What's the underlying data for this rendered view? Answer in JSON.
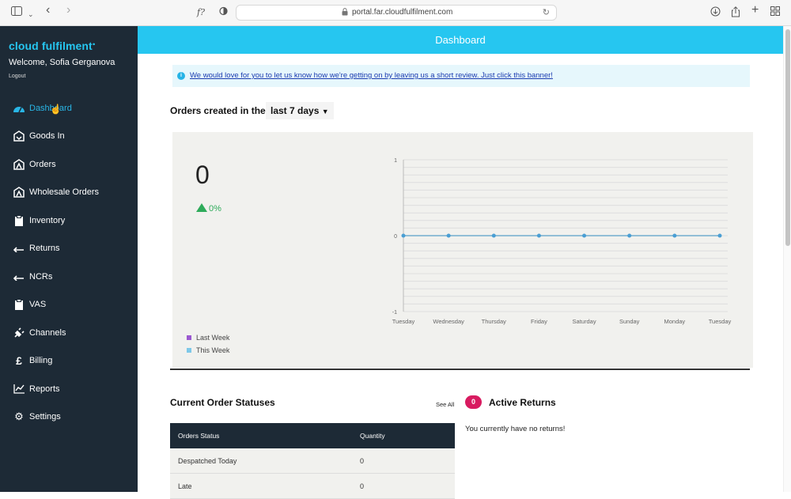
{
  "browser": {
    "url": "portal.far.cloudfulfilment.com",
    "icons": [
      "sidebar-toggle-icon",
      "chevron-down-icon",
      "back-icon",
      "forward-icon",
      "script-icon",
      "shield-icon",
      "lock-icon",
      "reload-icon",
      "download-icon",
      "share-icon",
      "new-tab-icon",
      "tab-overview-icon"
    ]
  },
  "sidebar": {
    "brand": "cloud fulfilment",
    "welcome": "Welcome, Sofia Gerganova",
    "logout": "Logout",
    "items": [
      {
        "label": "Dashboard",
        "icon": "dashboard-icon",
        "active": true
      },
      {
        "label": "Goods In",
        "icon": "box-in-icon"
      },
      {
        "label": "Orders",
        "icon": "order-box-icon"
      },
      {
        "label": "Wholesale Orders",
        "icon": "wholesale-box-icon"
      },
      {
        "label": "Inventory",
        "icon": "clipboard-icon"
      },
      {
        "label": "Returns",
        "icon": "return-arrow-icon"
      },
      {
        "label": "NCRs",
        "icon": "return-arrow-icon"
      },
      {
        "label": "VAS",
        "icon": "clipboard-icon"
      },
      {
        "label": "Channels",
        "icon": "plug-icon"
      },
      {
        "label": "Billing",
        "icon": "pound-icon"
      },
      {
        "label": "Reports",
        "icon": "line-chart-icon"
      },
      {
        "label": "Settings",
        "icon": "cogs-icon"
      }
    ]
  },
  "header": {
    "title": "Dashboard"
  },
  "banner": {
    "text": "We would love for you to let us know how we're getting on by leaving us a short review. Just click this banner!"
  },
  "orders": {
    "title": "Orders created in the",
    "range": "last 7 days",
    "total": "0",
    "change": "0%"
  },
  "chart_data": {
    "type": "line",
    "categories": [
      "Tuesday",
      "Wednesday",
      "Thursday",
      "Friday",
      "Saturday",
      "Sunday",
      "Monday",
      "Tuesday"
    ],
    "yticks": [
      "1",
      "0",
      "-1"
    ],
    "ylim": [
      -1,
      1
    ],
    "series": [
      {
        "name": "Last Week",
        "color": "#9b59d0",
        "values": [
          0,
          0,
          0,
          0,
          0,
          0,
          0,
          0
        ]
      },
      {
        "name": "This Week",
        "color": "#7ec8e8",
        "values": [
          0,
          0,
          0,
          0,
          0,
          0,
          0,
          0
        ]
      }
    ],
    "grid": true,
    "legend": "bottom-left"
  },
  "statuses": {
    "title": "Current Order Statuses",
    "see_all": "See All",
    "columns": [
      "Orders Status",
      "Quantity"
    ],
    "rows": [
      {
        "status": "Despatched Today",
        "qty": "0"
      },
      {
        "status": "Late",
        "qty": "0"
      }
    ]
  },
  "returns": {
    "count": "0",
    "title": "Active Returns",
    "empty": "You currently have no returns!"
  }
}
